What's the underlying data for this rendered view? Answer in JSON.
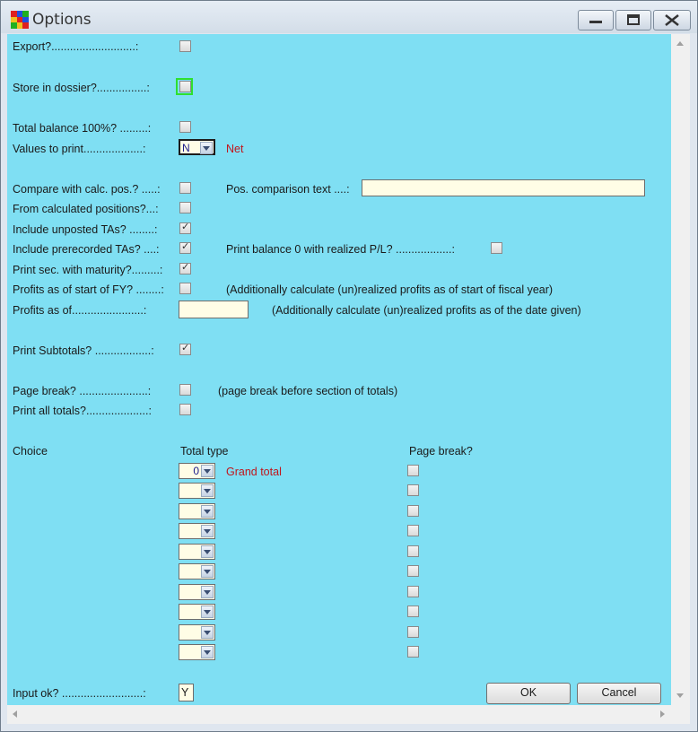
{
  "window": {
    "title": "Options"
  },
  "rows": {
    "export": {
      "label": "Export?...........................:",
      "checked": false
    },
    "store": {
      "label": "Store in dossier?................:",
      "checked": false
    },
    "total_balance": {
      "label": "Total balance 100%? .........:",
      "checked": false
    },
    "values_to_print": {
      "label": "Values to print...................:",
      "value": "N",
      "desc": "Net"
    },
    "compare_calc": {
      "label": "Compare with calc. pos.? .....:",
      "checked": false
    },
    "pos_comparison": {
      "label": "Pos. comparison text ....:",
      "value": ""
    },
    "from_calc": {
      "label": "From calculated positions?...:",
      "checked": false
    },
    "unposted": {
      "label": "Include unposted TAs? ........:",
      "checked": true
    },
    "prerecorded": {
      "label": "Include prerecorded TAs? ....:",
      "checked": true
    },
    "print_balance0": {
      "label": "Print balance 0 with realized P/L? ..................:",
      "checked": false
    },
    "print_maturity": {
      "label": "Print sec. with maturity?.........:",
      "checked": true
    },
    "profits_start_fy": {
      "label": "Profits as of start of FY? ........:",
      "checked": false,
      "note": "(Additionally calculate (un)realized profits as of start of fiscal year)"
    },
    "profits_as_of": {
      "label": "Profits as of.......................:",
      "value": "",
      "note": "(Additionally calculate (un)realized profits as of the date given)"
    },
    "print_subtotals": {
      "label": "Print Subtotals? ..................:",
      "checked": true
    },
    "page_break": {
      "label": "Page break? ......................:",
      "checked": false,
      "note": "(page break before section of totals)"
    },
    "print_all_totals": {
      "label": "Print all totals?....................:",
      "checked": false
    },
    "input_ok": {
      "label": "Input ok? ..........................:",
      "value": "Y"
    }
  },
  "totals_table": {
    "headers": {
      "choice": "Choice",
      "total_type": "Total type",
      "page_break": "Page break?"
    },
    "rows": [
      {
        "total_type": "0",
        "desc": "Grand total",
        "page_break": false
      },
      {
        "total_type": "",
        "desc": "",
        "page_break": false
      },
      {
        "total_type": "",
        "desc": "",
        "page_break": false
      },
      {
        "total_type": "",
        "desc": "",
        "page_break": false
      },
      {
        "total_type": "",
        "desc": "",
        "page_break": false
      },
      {
        "total_type": "",
        "desc": "",
        "page_break": false
      },
      {
        "total_type": "",
        "desc": "",
        "page_break": false
      },
      {
        "total_type": "",
        "desc": "",
        "page_break": false
      },
      {
        "total_type": "",
        "desc": "",
        "page_break": false
      },
      {
        "total_type": "",
        "desc": "",
        "page_break": false
      }
    ]
  },
  "buttons": {
    "ok": "OK",
    "cancel": "Cancel"
  },
  "colors": {
    "client_bg": "#7fdff3",
    "red_text": "#c0161c",
    "input_bg": "#fffde6",
    "focus": "#2ee02e"
  }
}
